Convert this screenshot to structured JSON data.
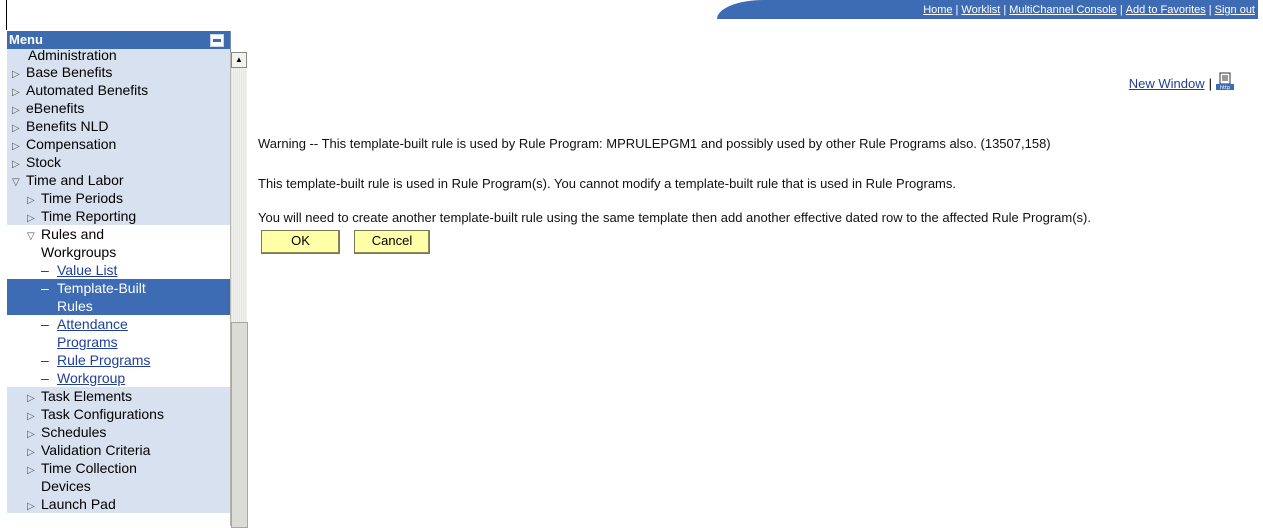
{
  "top_nav": {
    "links": [
      "Home",
      "Worklist",
      "MultiChannel Console",
      "Add to Favorites",
      "Sign out"
    ]
  },
  "menu": {
    "title": "Menu",
    "items_top": [
      {
        "label": "Administration",
        "level": "partial"
      },
      {
        "label": "Base Benefits",
        "level": 1,
        "expanded": false
      },
      {
        "label": "Automated Benefits",
        "level": 1,
        "expanded": false
      },
      {
        "label": "eBenefits",
        "level": 1,
        "expanded": false
      },
      {
        "label": "Benefits NLD",
        "level": 1,
        "expanded": false
      },
      {
        "label": "Compensation",
        "level": 1,
        "expanded": false
      },
      {
        "label": "Stock",
        "level": 1,
        "expanded": false
      },
      {
        "label": "Time and Labor",
        "level": 1,
        "expanded": true
      },
      {
        "label": "Time Periods",
        "level": 2,
        "expanded": false
      },
      {
        "label": "Time Reporting",
        "level": 2,
        "expanded": false
      }
    ],
    "rules_workgroups": {
      "label_line1": "Rules and",
      "label_line2": "Workgroups"
    },
    "sub_items": {
      "value_list": "Value List",
      "template_built_line1": "Template-Built",
      "template_built_line2": "Rules",
      "attendance_line1": "Attendance",
      "attendance_line2": "Programs",
      "rule_programs": "Rule Programs",
      "workgroup": "Workgroup"
    },
    "items_bottom": [
      {
        "label": "Task Elements"
      },
      {
        "label": "Task Configurations"
      },
      {
        "label": "Schedules"
      },
      {
        "label": "Validation Criteria"
      },
      {
        "label": "Time Collection"
      }
    ],
    "devices": "Devices",
    "launch_pad": "Launch Pad"
  },
  "content": {
    "new_window": "New Window",
    "warning": "Warning -- This template-built rule is used by Rule Program: MPRULEPGM1 and possibly used by other Rule Programs also. (13507,158)",
    "line2": "This template-built rule is used in Rule Program(s). You cannot modify a template-built rule that is used in Rule Programs.",
    "line3": "You will need to create another template-built rule using the same template then add another effective dated row to the affected Rule Program(s).",
    "ok_label": "OK",
    "cancel_label": "Cancel"
  },
  "colors": {
    "nav_blue": "#3e6cb4",
    "menu_bg": "#d8e1ef",
    "button_yellow": "#ffffa8",
    "link_blue": "#1f3f9a"
  }
}
